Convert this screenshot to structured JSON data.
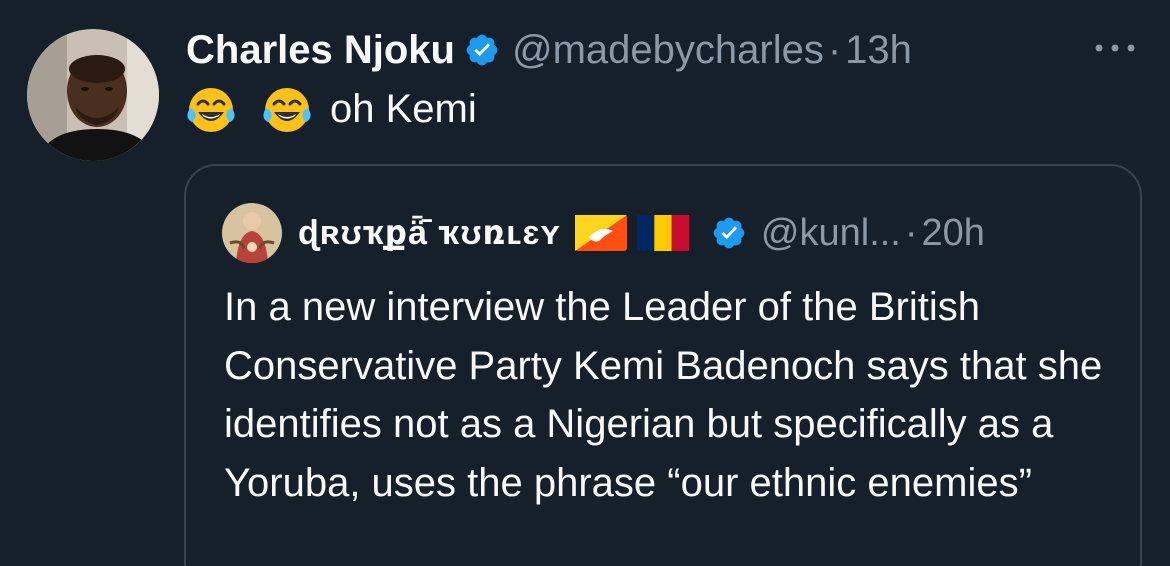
{
  "tweet": {
    "author_name": "Charles Njoku",
    "author_handle": "@madebycharles",
    "separator": "·",
    "time": "13h",
    "text": "oh Kemi",
    "emojis": [
      "face-with-tears-of-joy",
      "face-with-tears-of-joy"
    ],
    "verified_color": "#1d9bf0"
  },
  "quoted": {
    "author_name": "ɖʀʊҡքǟ̄ ҡʊռʟɛʏ",
    "author_handle": "@kunl...",
    "separator": "·",
    "time": "20h",
    "flags": [
      "bhutan-flag",
      "chad-flag"
    ],
    "text": "In a new interview the Leader of the British Conservative Party Kemi Badenoch says that she identifies not as a Nigerian but specifically as a Yoruba, uses the phrase “our ethnic enemies”"
  },
  "colors": {
    "background": "#15202b",
    "primary_text": "#f7f9f9",
    "secondary_text": "#8b98a5",
    "border": "#38444d",
    "accent": "#1d9bf0"
  }
}
